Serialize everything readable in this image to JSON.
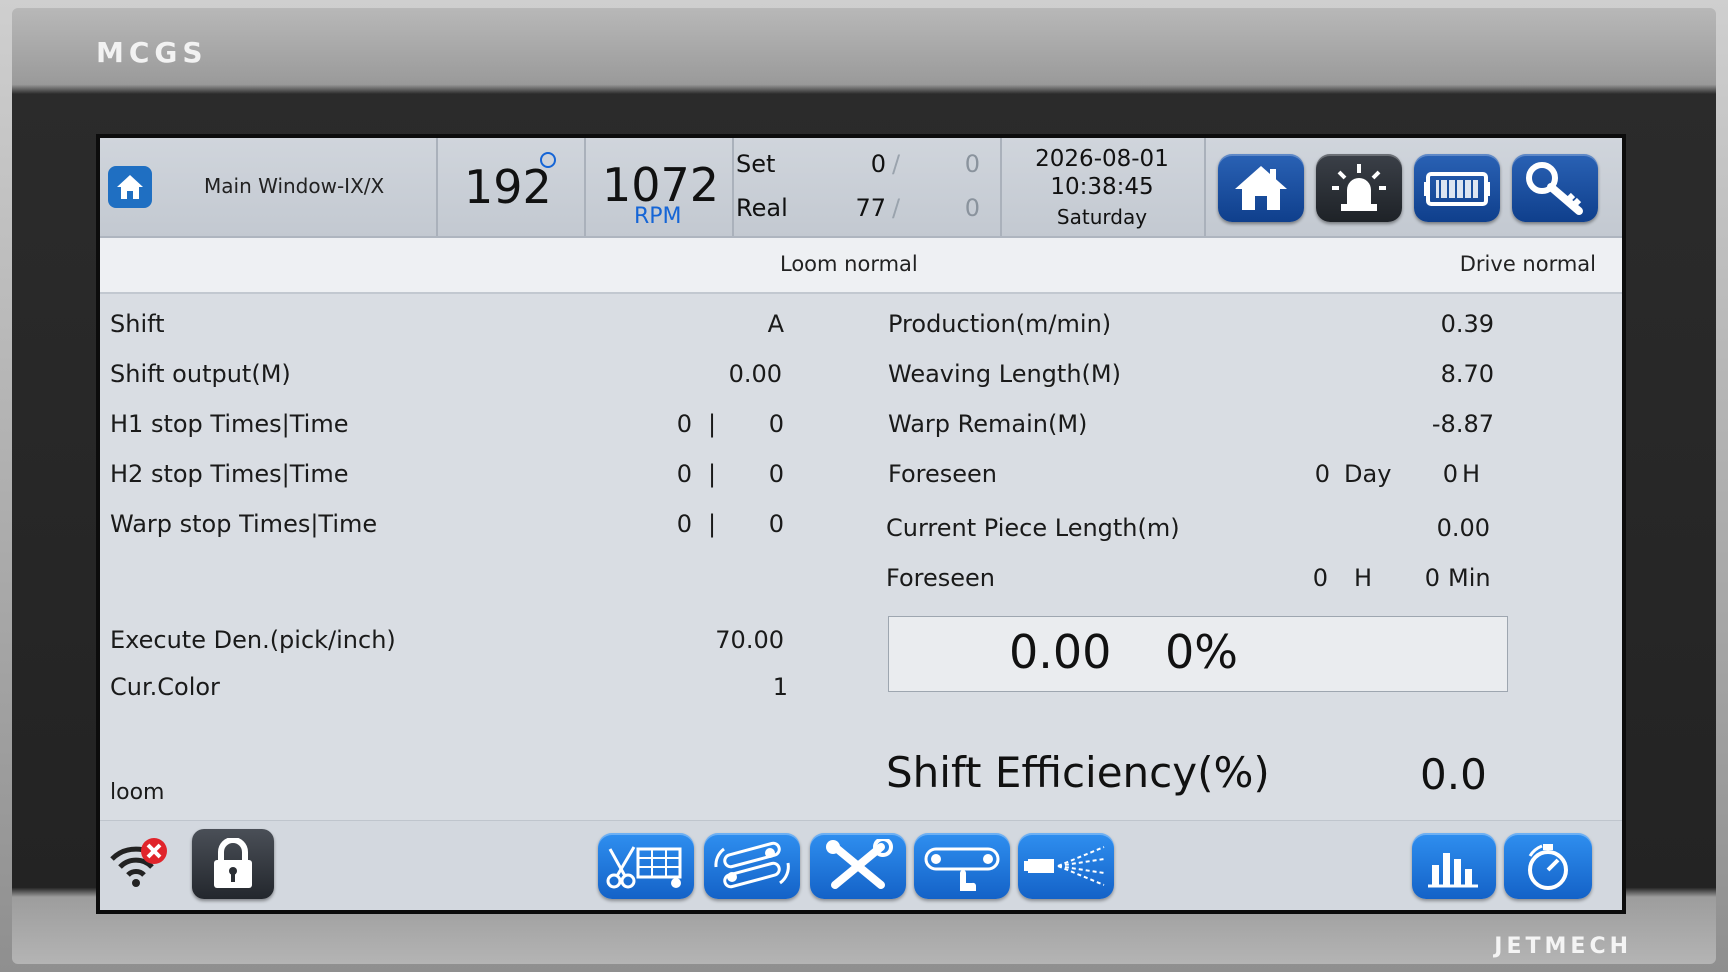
{
  "device": {
    "brand_top": "MCGS",
    "brand_bottom": "JETMECH"
  },
  "header": {
    "window_title": "Main Window-IX/X",
    "angle_value": "192",
    "speed_value": "1072",
    "speed_unit": "RPM",
    "set_label": "Set",
    "set_value": "0",
    "set_value2": "0",
    "real_label": "Real",
    "real_value": "77",
    "real_value2": "0",
    "separator": "/",
    "date": "2026-08-01",
    "time": "10:38:45",
    "weekday": "Saturday"
  },
  "status": {
    "loom": "Loom normal",
    "drive": "Drive normal"
  },
  "left": {
    "rows": [
      {
        "label": "Shift",
        "value": "A"
      },
      {
        "label": "Shift output(M)",
        "value": "0.00"
      },
      {
        "label": "H1 stop Times|Time",
        "times": "0",
        "sep": "|",
        "time": "0"
      },
      {
        "label": "H2 stop Times|Time",
        "times": "0",
        "sep": "|",
        "time": "0"
      },
      {
        "label": "Warp stop Times|Time",
        "times": "0",
        "sep": "|",
        "time": "0"
      }
    ],
    "density_label": "Execute Den.(pick/inch)",
    "density_value": "70.00",
    "color_label": "Cur.Color",
    "color_value": "1",
    "footer_label": "loom"
  },
  "right": {
    "production_label": "Production(m/min)",
    "production_value": "0.39",
    "weaving_label": "Weaving Length(M)",
    "weaving_value": "8.70",
    "warp_label": "Warp Remain(M)",
    "warp_value": "-8.87",
    "foreseen1_label": "Foreseen",
    "foreseen1_days": "0",
    "foreseen1_day_unit": "Day",
    "foreseen1_hours": "0",
    "foreseen1_hour_unit": "H",
    "piece_label": "Current Piece Length(m)",
    "piece_value": "0.00",
    "foreseen2_label": "Foreseen",
    "foreseen2_hours": "0",
    "foreseen2_hour_unit": "H",
    "foreseen2_mins": "0",
    "foreseen2_min_unit": "Min",
    "box_value": "0.00",
    "box_percent": "0%",
    "efficiency_label": "Shift Efficiency(%)",
    "efficiency_value": "0.0"
  },
  "icons": {
    "top": [
      "home-icon",
      "alarm-light-icon",
      "machine-icon",
      "key-icon"
    ],
    "bottom": [
      "wifi-disconnected-icon",
      "lock-icon",
      "cut-fabric-icon",
      "rollers-icon",
      "tools-icon",
      "conveyor-hand-icon",
      "spray-nozzle-icon",
      "bar-chart-icon",
      "timer-icon"
    ]
  },
  "colors": {
    "accent": "#1f6fc2",
    "rpm_blue": "#1565d6",
    "button_dark_blue": "#0f3f8c",
    "button_light_blue": "#2f8ff0",
    "alert_red": "#e0242b"
  }
}
